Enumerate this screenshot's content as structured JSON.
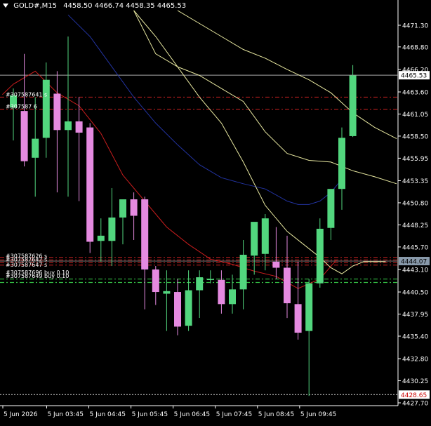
{
  "header": {
    "symbol": "GOLD#,M15",
    "ohlc": "4458.50 4466.74 4458.35 4465.53"
  },
  "price_labels": {
    "bid": "4465.53",
    "ask": "4444.07",
    "low_marker": "4428.65"
  },
  "order_labels_top": [
    "#307587641 s",
    "#307587 6"
  ],
  "order_labels_bottom": [
    "#307587626 s",
    "#307587642 s",
    "#307587647 s",
    "#307587696 buy 0.10",
    "#307587649 buy 0.10"
  ],
  "colors": {
    "background": "#000000",
    "bull": "#52d67e",
    "bear": "#e58ae0",
    "wick_bull": "#52d67e",
    "wick_bear": "#e58ae0",
    "ma_red": "#c81d1d",
    "ma_blue": "#2233a0",
    "ma_yellow": "#e8e8a0",
    "order_red": "#cc2222",
    "order_green": "#33bb44",
    "axis_text": "#ffffff"
  },
  "chart_data": {
    "type": "candlestick",
    "title": "GOLD#,M15",
    "ylim": [
      4427.7,
      4473.0
    ],
    "yticks": [
      4471.3,
      4468.8,
      4466.2,
      4463.6,
      4461.05,
      4458.5,
      4455.95,
      4453.35,
      4450.8,
      4448.25,
      4445.7,
      4443.1,
      4440.5,
      4437.95,
      4435.4,
      4432.8,
      4430.25,
      4427.7
    ],
    "xticks": [
      "5 Jun 2026",
      "5 Jun 03:45",
      "5 Jun 04:45",
      "5 Jun 05:45",
      "5 Jun 06:45",
      "5 Jun 07:45",
      "5 Jun 08:45",
      "5 Jun 09:45"
    ],
    "candles": [
      {
        "o": 4461.8,
        "h": 4464.0,
        "l": 4458.0,
        "c": 4463.2
      },
      {
        "o": 4461.4,
        "h": 4468.0,
        "l": 4455.0,
        "c": 4455.6
      },
      {
        "o": 4456.0,
        "h": 4463.0,
        "l": 4451.5,
        "c": 4458.2
      },
      {
        "o": 4458.3,
        "h": 4467.0,
        "l": 4456.0,
        "c": 4465.0
      },
      {
        "o": 4463.4,
        "h": 4466.0,
        "l": 4452.0,
        "c": 4459.2
      },
      {
        "o": 4459.2,
        "h": 4470.0,
        "l": 4451.5,
        "c": 4460.2
      },
      {
        "o": 4460.2,
        "h": 4463.0,
        "l": 4451.0,
        "c": 4458.9
      },
      {
        "o": 4459.5,
        "h": 4460.0,
        "l": 4445.0,
        "c": 4446.3
      },
      {
        "o": 4446.4,
        "h": 4449.0,
        "l": 4444.0,
        "c": 4447.0
      },
      {
        "o": 4446.4,
        "h": 4452.5,
        "l": 4443.5,
        "c": 4449.1
      },
      {
        "o": 4449.1,
        "h": 4451.0,
        "l": 4446.0,
        "c": 4451.2
      },
      {
        "o": 4451.2,
        "h": 4452.0,
        "l": 4446.5,
        "c": 4449.3
      },
      {
        "o": 4451.2,
        "h": 4451.5,
        "l": 4438.5,
        "c": 4443.1
      },
      {
        "o": 4443.1,
        "h": 4443.5,
        "l": 4439.0,
        "c": 4440.5
      },
      {
        "o": 4440.3,
        "h": 4443.0,
        "l": 4436.0,
        "c": 4440.6
      },
      {
        "o": 4440.5,
        "h": 4442.0,
        "l": 4435.5,
        "c": 4436.5
      },
      {
        "o": 4436.6,
        "h": 4443.0,
        "l": 4436.0,
        "c": 4440.7
      },
      {
        "o": 4440.7,
        "h": 4443.0,
        "l": 4437.5,
        "c": 4442.2
      },
      {
        "o": 4442.0,
        "h": 4443.0,
        "l": 4441.5,
        "c": 4442.0
      },
      {
        "o": 4441.9,
        "h": 4443.0,
        "l": 4438.0,
        "c": 4439.1
      },
      {
        "o": 4439.1,
        "h": 4442.5,
        "l": 4438.0,
        "c": 4440.8
      },
      {
        "o": 4440.8,
        "h": 4446.5,
        "l": 4438.5,
        "c": 4444.8
      },
      {
        "o": 4444.7,
        "h": 4448.5,
        "l": 4442.5,
        "c": 4448.6
      },
      {
        "o": 4444.9,
        "h": 4449.5,
        "l": 4443.0,
        "c": 4449.0
      },
      {
        "o": 4444.0,
        "h": 4448.0,
        "l": 4442.0,
        "c": 4443.3
      },
      {
        "o": 4443.3,
        "h": 4447.0,
        "l": 4437.5,
        "c": 4439.2
      },
      {
        "o": 4439.1,
        "h": 4444.0,
        "l": 4435.0,
        "c": 4435.8
      },
      {
        "o": 4436.0,
        "h": 4442.0,
        "l": 4428.5,
        "c": 4441.5
      },
      {
        "o": 4441.5,
        "h": 4449.0,
        "l": 4441.0,
        "c": 4447.8
      },
      {
        "o": 4447.9,
        "h": 4452.0,
        "l": 4446.5,
        "c": 4452.4
      },
      {
        "o": 4452.4,
        "h": 4459.5,
        "l": 4450.0,
        "c": 4458.3
      },
      {
        "o": 4458.5,
        "h": 4466.7,
        "l": 4458.4,
        "c": 4465.5
      }
    ],
    "series": [
      {
        "name": "",
        "color": "#c81d1d",
        "x": [
          -1,
          0,
          2,
          4,
          6,
          8,
          10,
          12,
          14,
          16,
          18,
          20,
          22,
          24,
          26,
          28,
          29.5
        ],
        "values": [
          4463.3,
          4464.5,
          4466.0,
          4463.5,
          4462.0,
          4458.8,
          4454.0,
          4451.0,
          4448.0,
          4446.0,
          4444.3,
          4443.7,
          4442.9,
          4442.3,
          4440.9,
          4442.0,
          4444.2
        ]
      },
      {
        "name": "",
        "color": "#2233a0",
        "x": [
          5,
          7,
          9,
          11,
          13,
          15,
          17,
          19,
          21,
          23,
          25,
          26,
          27,
          28,
          29,
          30
        ],
        "values": [
          4472.5,
          4470.0,
          4466.5,
          4463.0,
          4460.0,
          4457.5,
          4455.2,
          4453.7,
          4453.0,
          4452.4,
          4451.0,
          4450.6,
          4450.6,
          4451.0,
          4452.0,
          4453.5
        ]
      },
      {
        "name": "",
        "color": "#e8e8a0",
        "x": [
          11,
          13,
          15,
          17,
          19,
          21,
          23,
          25,
          27,
          28,
          29,
          30,
          31,
          32,
          33,
          34
        ],
        "values": [
          4473.0,
          4470.0,
          4466.5,
          4463.0,
          4460.0,
          4455.5,
          4450.5,
          4447.5,
          4445.5,
          4444.5,
          4443.3,
          4442.6,
          4443.5,
          4444.0,
          4444.0,
          4444.0
        ]
      },
      {
        "name": "",
        "color": "#e8e8a0",
        "x": [
          15,
          17,
          19,
          21,
          23,
          25,
          27,
          29,
          31,
          33,
          35
        ],
        "values": [
          4473.0,
          4471.5,
          4470.0,
          4468.5,
          4467.5,
          4466.2,
          4465.0,
          4463.5,
          4461.2,
          4459.5,
          4458.2
        ]
      },
      {
        "name": "",
        "color": "#e8e8a0",
        "x": [
          11,
          13,
          15,
          17,
          19,
          21,
          23,
          25,
          27,
          29,
          31,
          33,
          35
        ],
        "values": [
          4473.0,
          4468.0,
          4466.5,
          4465.5,
          4464.0,
          4462.5,
          4459.0,
          4456.5,
          4455.7,
          4455.5,
          4454.5,
          4453.8,
          4453.0
        ]
      }
    ]
  }
}
